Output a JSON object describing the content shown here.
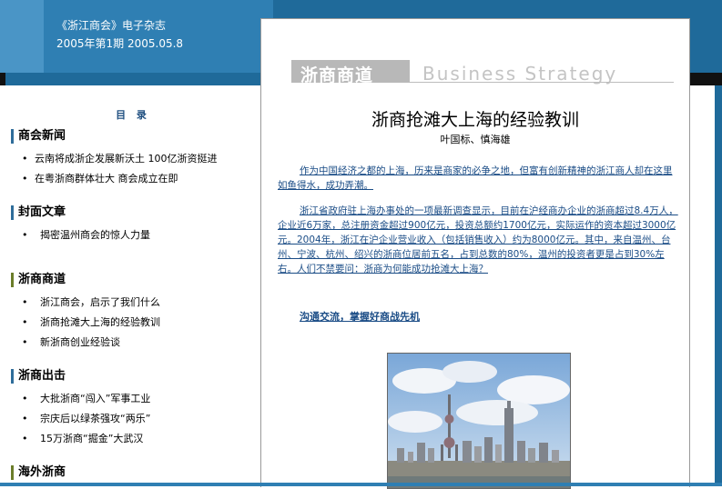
{
  "header": {
    "magazine": "《浙江商会》电子杂志",
    "issue": "2005年第1期  2005.05.8"
  },
  "sidebar": {
    "toc_title": "目 录",
    "sections": [
      {
        "title": "商会新闻",
        "items": [
          "云南将成浙企发展新沃土 100亿浙资挺进",
          "在粤浙商群体壮大 商会成立在即"
        ]
      },
      {
        "title": "封面文章",
        "items": [
          "揭密温州商会的惊人力量"
        ]
      },
      {
        "title": "浙商商道",
        "items": [
          "浙江商会，启示了我们什么",
          "浙商抢滩大上海的经验教训",
          "新浙商创业经验谈"
        ]
      },
      {
        "title": "浙商出击",
        "items": [
          "大批浙商“闯入”军事工业",
          "宗庆后以绿茶强攻“两乐”",
          "15万浙商“掘金”大武汉"
        ]
      },
      {
        "title": "海外浙商",
        "items": []
      }
    ]
  },
  "article": {
    "banner_cn": "浙商商道",
    "banner_en": "Business Strategy",
    "title": "浙商抢滩大上海的经验教训",
    "author": "叶国标、慎海雄",
    "paragraph1": "作为中国经济之都的上海，历来是商家的必争之地，但富有创新精神的浙江商人却在这里如鱼得水，成功弄潮。",
    "paragraph2": "浙江省政府驻上海办事处的一项最新调查显示，目前在沪经商办企业的浙商超过8.4万人，企业近6万家，总注册资金超过900亿元，投资总额约1700亿元，实际运作的资本超过3000亿元。2004年，浙江在沪企业营业收入（包括销售收入）约为8000亿元。其中，来自温州、台州、宁波、杭州、绍兴的浙商位居前五名，占到总数的80%，温州的投资者更是占到30%左右。人们不禁要问：浙商为何能成功抢滩大上海？",
    "subheading": "沟通交流，掌握好商战先机"
  },
  "colors": {
    "header_blue": "#2f7fb3",
    "link_blue": "#1a4c86"
  }
}
